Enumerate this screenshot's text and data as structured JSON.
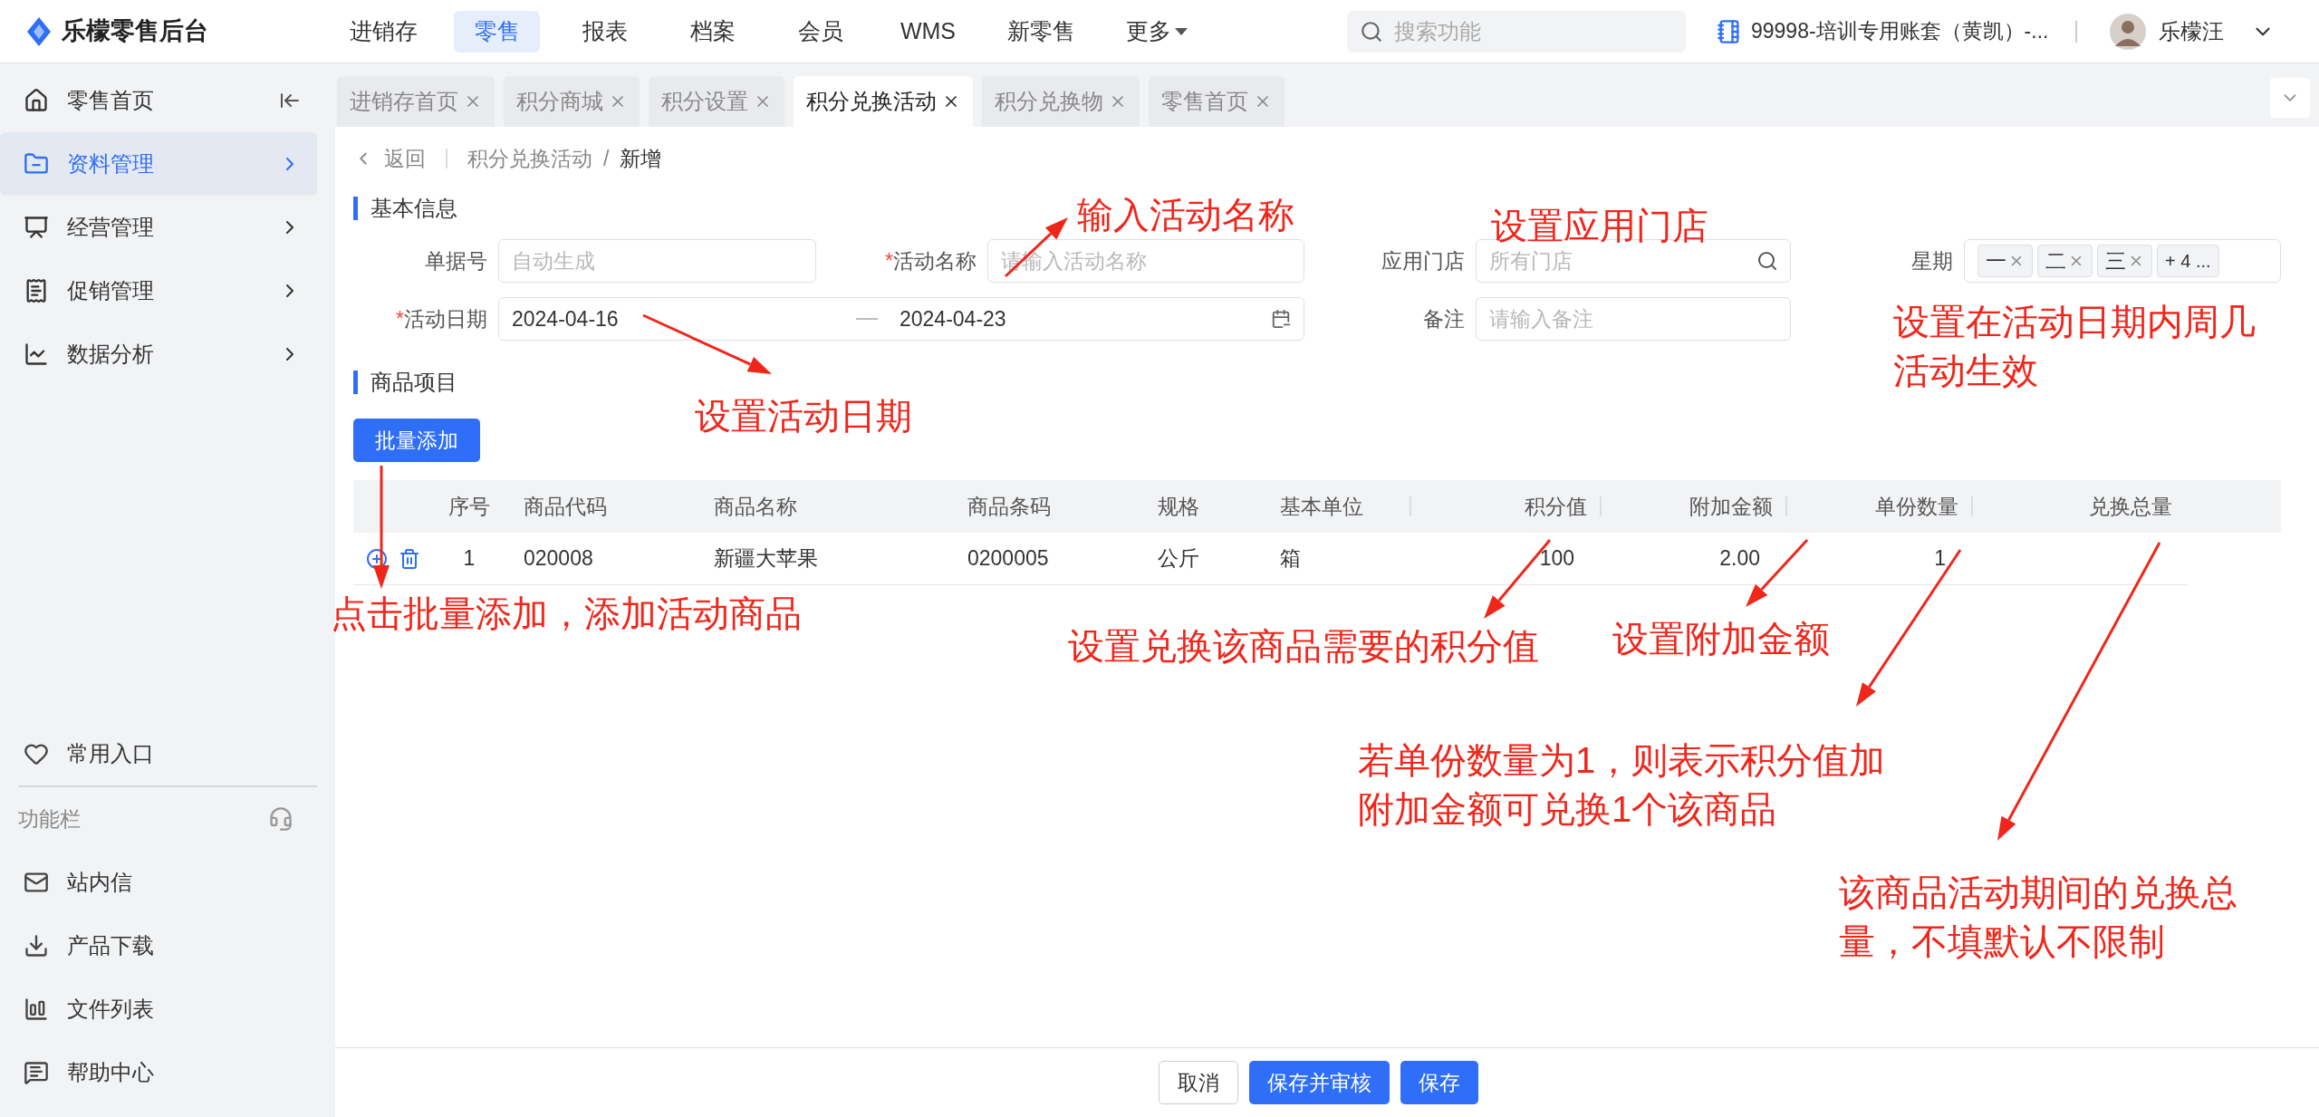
{
  "app": {
    "title": "乐檬零售后台"
  },
  "top_nav": [
    {
      "label": "进销存",
      "selected": false,
      "dropdown": false
    },
    {
      "label": "零售",
      "selected": true,
      "dropdown": false
    },
    {
      "label": "报表",
      "selected": false,
      "dropdown": false
    },
    {
      "label": "档案",
      "selected": false,
      "dropdown": false
    },
    {
      "label": "会员",
      "selected": false,
      "dropdown": false
    },
    {
      "label": "WMS",
      "selected": false,
      "dropdown": false
    },
    {
      "label": "新零售",
      "selected": false,
      "dropdown": false
    },
    {
      "label": "更多",
      "selected": false,
      "dropdown": true
    }
  ],
  "search": {
    "placeholder": "搜索功能"
  },
  "account": "99998-培训专用账套（黄凯）-...",
  "user": {
    "name": "乐檬汪"
  },
  "sidebar": {
    "items": [
      {
        "label": "零售首页",
        "selected": false,
        "expandable": false
      },
      {
        "label": "资料管理",
        "selected": true,
        "expandable": true
      },
      {
        "label": "经营管理",
        "selected": false,
        "expandable": true
      },
      {
        "label": "促销管理",
        "selected": false,
        "expandable": true
      },
      {
        "label": "数据分析",
        "selected": false,
        "expandable": true
      }
    ],
    "shortcuts": "常用入口",
    "toolbar_title": "功能栏",
    "tools": [
      "站内信",
      "产品下载",
      "文件列表",
      "帮助中心"
    ]
  },
  "tabs": [
    {
      "label": "进销存首页",
      "selected": false
    },
    {
      "label": "积分商城",
      "selected": false
    },
    {
      "label": "积分设置",
      "selected": false
    },
    {
      "label": "积分兑换活动",
      "selected": true
    },
    {
      "label": "积分兑换物",
      "selected": false
    },
    {
      "label": "零售首页",
      "selected": false
    }
  ],
  "breadcrumb": {
    "back": "返回",
    "separator": "/",
    "path": [
      "积分兑换活动",
      "新增"
    ]
  },
  "basic_info": {
    "title": "基本信息",
    "required_mark": "*",
    "fields": [
      {
        "kind": "text",
        "label": "单据号",
        "required": false,
        "placeholder": "自动生成"
      },
      {
        "kind": "text",
        "label": "活动名称",
        "required": true,
        "placeholder": "请输入活动名称"
      },
      {
        "kind": "search",
        "label": "应用门店",
        "required": false,
        "placeholder": "所有门店"
      },
      {
        "kind": "tags",
        "label": "星期",
        "required": false,
        "tags": [
          "一",
          "二",
          "三"
        ],
        "more": "+ 4 ..."
      },
      {
        "kind": "date_range",
        "label": "活动日期",
        "required": true,
        "start": "2024-04-16",
        "end": "2024-04-23"
      },
      {
        "kind": "text",
        "label": "备注",
        "required": false,
        "placeholder": "请输入备注"
      }
    ]
  },
  "products": {
    "title": "商品项目",
    "add_button": "批量添加",
    "table": {
      "columns": [
        "序号",
        "商品代码",
        "商品名称",
        "商品条码",
        "规格",
        "基本单位",
        "积分值",
        "附加金额",
        "单份数量",
        "兑换总量"
      ],
      "rows": [
        {
          "cells": [
            "1",
            "020008",
            "新疆大苹果",
            "0200005",
            "公斤",
            "箱",
            "100",
            "2.00",
            "1"
          ]
        }
      ]
    }
  },
  "footer_buttons": [
    {
      "label": "取消",
      "kind": "secondary"
    },
    {
      "label": "保存并审核",
      "kind": "primary"
    },
    {
      "label": "保存",
      "kind": "primary"
    }
  ],
  "annotations": [
    {
      "lines": [
        "输入活动名称"
      ]
    },
    {
      "lines": [
        "设置应用门店"
      ]
    },
    {
      "lines": [
        "设置在活动日期内周几",
        "活动生效"
      ]
    },
    {
      "lines": [
        "设置活动日期"
      ]
    },
    {
      "lines": [
        "点击批量添加，添加活动商品"
      ]
    },
    {
      "lines": [
        "设置兑换该商品需要的积分值"
      ]
    },
    {
      "lines": [
        "设置附加金额"
      ]
    },
    {
      "lines": [
        "若单份数量为1，则表示积分值加",
        "附加金额可兑换1个该商品"
      ]
    },
    {
      "lines": [
        "该商品活动期间的兑换总",
        "量，不填默认不限制"
      ]
    }
  ]
}
